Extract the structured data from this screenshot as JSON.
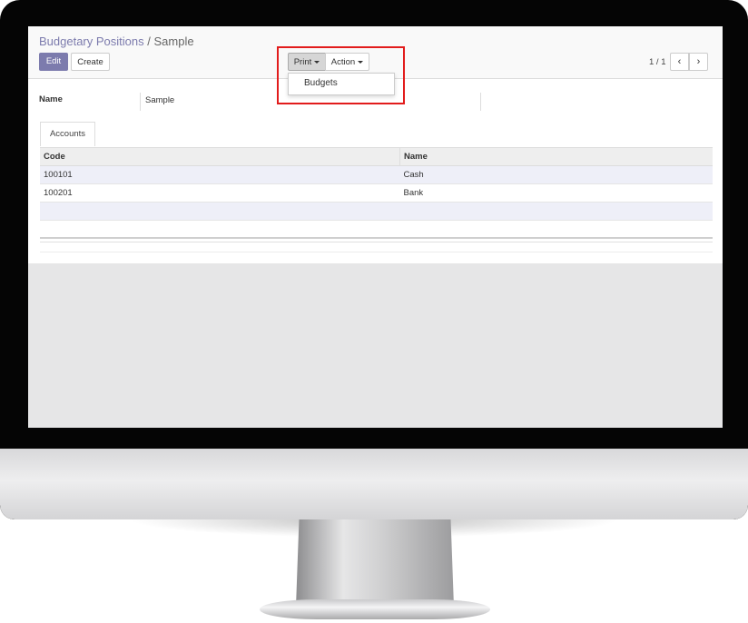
{
  "breadcrumb": {
    "parent": "Budgetary Positions",
    "separator": "/",
    "current": "Sample"
  },
  "buttons": {
    "edit": "Edit",
    "create": "Create",
    "print": "Print",
    "action": "Action"
  },
  "print_menu": {
    "items": [
      "Budgets"
    ]
  },
  "pager": {
    "value": "1 / 1",
    "prev": "‹",
    "next": "›"
  },
  "form": {
    "name_label": "Name",
    "name_value": "Sample"
  },
  "tabs": [
    "Accounts"
  ],
  "table": {
    "columns": [
      "Code",
      "Name"
    ],
    "rows": [
      {
        "code": "100101",
        "name": "Cash"
      },
      {
        "code": "100201",
        "name": "Bank"
      }
    ]
  },
  "colors": {
    "brand": "#7c7bad",
    "highlight": "#e21c1c"
  }
}
